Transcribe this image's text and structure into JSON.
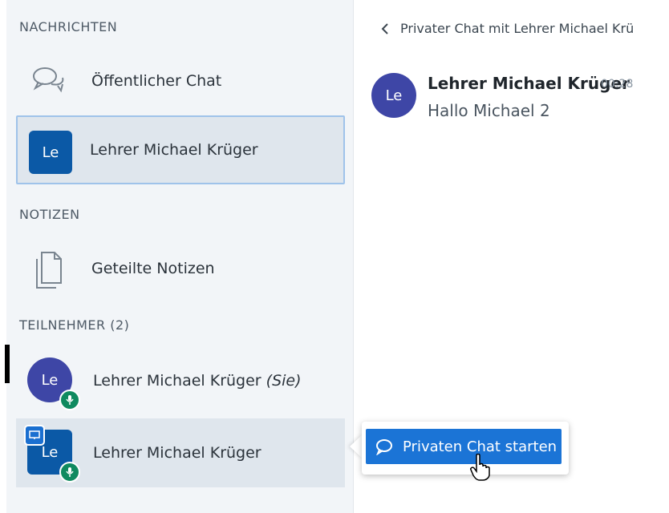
{
  "sidebar": {
    "messages_title": "NACHRICHTEN",
    "public_chat_label": "Öffentlicher Chat",
    "private_chat_initials": "Le",
    "private_chat_label": "Lehrer Michael Krüger",
    "notes_title": "NOTIZEN",
    "shared_notes_label": "Geteilte Notizen",
    "participants_title": "TEILNEHMER (2)",
    "participants": [
      {
        "initials": "Le",
        "name": "Lehrer Michael Krüger",
        "suffix": "(Sie)"
      },
      {
        "initials": "Le",
        "name": "Lehrer Michael Krüger"
      }
    ]
  },
  "chat": {
    "header": "Privater Chat mit Lehrer Michael Krü",
    "message": {
      "initials": "Le",
      "author": "Lehrer Michael Krüger",
      "time": "00:28",
      "text": "Hallo Michael 2"
    }
  },
  "popup": {
    "button_label": "Privaten Chat starten"
  },
  "colors": {
    "accent": "#1b74d6",
    "avatar_square": "#0b59a6",
    "avatar_round": "#3e46a6",
    "mic_badge": "#0f8a5f"
  }
}
